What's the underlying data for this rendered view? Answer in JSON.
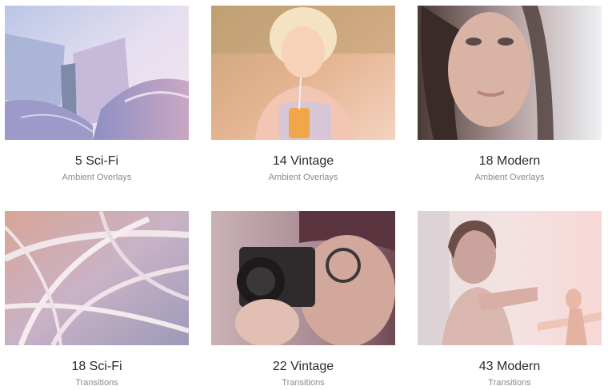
{
  "cards": [
    {
      "title": "5 Sci-Fi",
      "subtitle": "Ambient Overlays",
      "image": "sci-fi-architecture-image"
    },
    {
      "title": "14 Vintage",
      "subtitle": "Ambient Overlays",
      "image": "vintage-woman-drink-image"
    },
    {
      "title": "18 Modern",
      "subtitle": "Ambient Overlays",
      "image": "modern-portrait-image"
    },
    {
      "title": "18 Sci-Fi",
      "subtitle": "Transitions",
      "image": "sci-fi-highway-image"
    },
    {
      "title": "22 Vintage",
      "subtitle": "Transitions",
      "image": "vintage-camera-image"
    },
    {
      "title": "43 Modern",
      "subtitle": "Transitions",
      "image": "modern-yoga-image"
    }
  ]
}
